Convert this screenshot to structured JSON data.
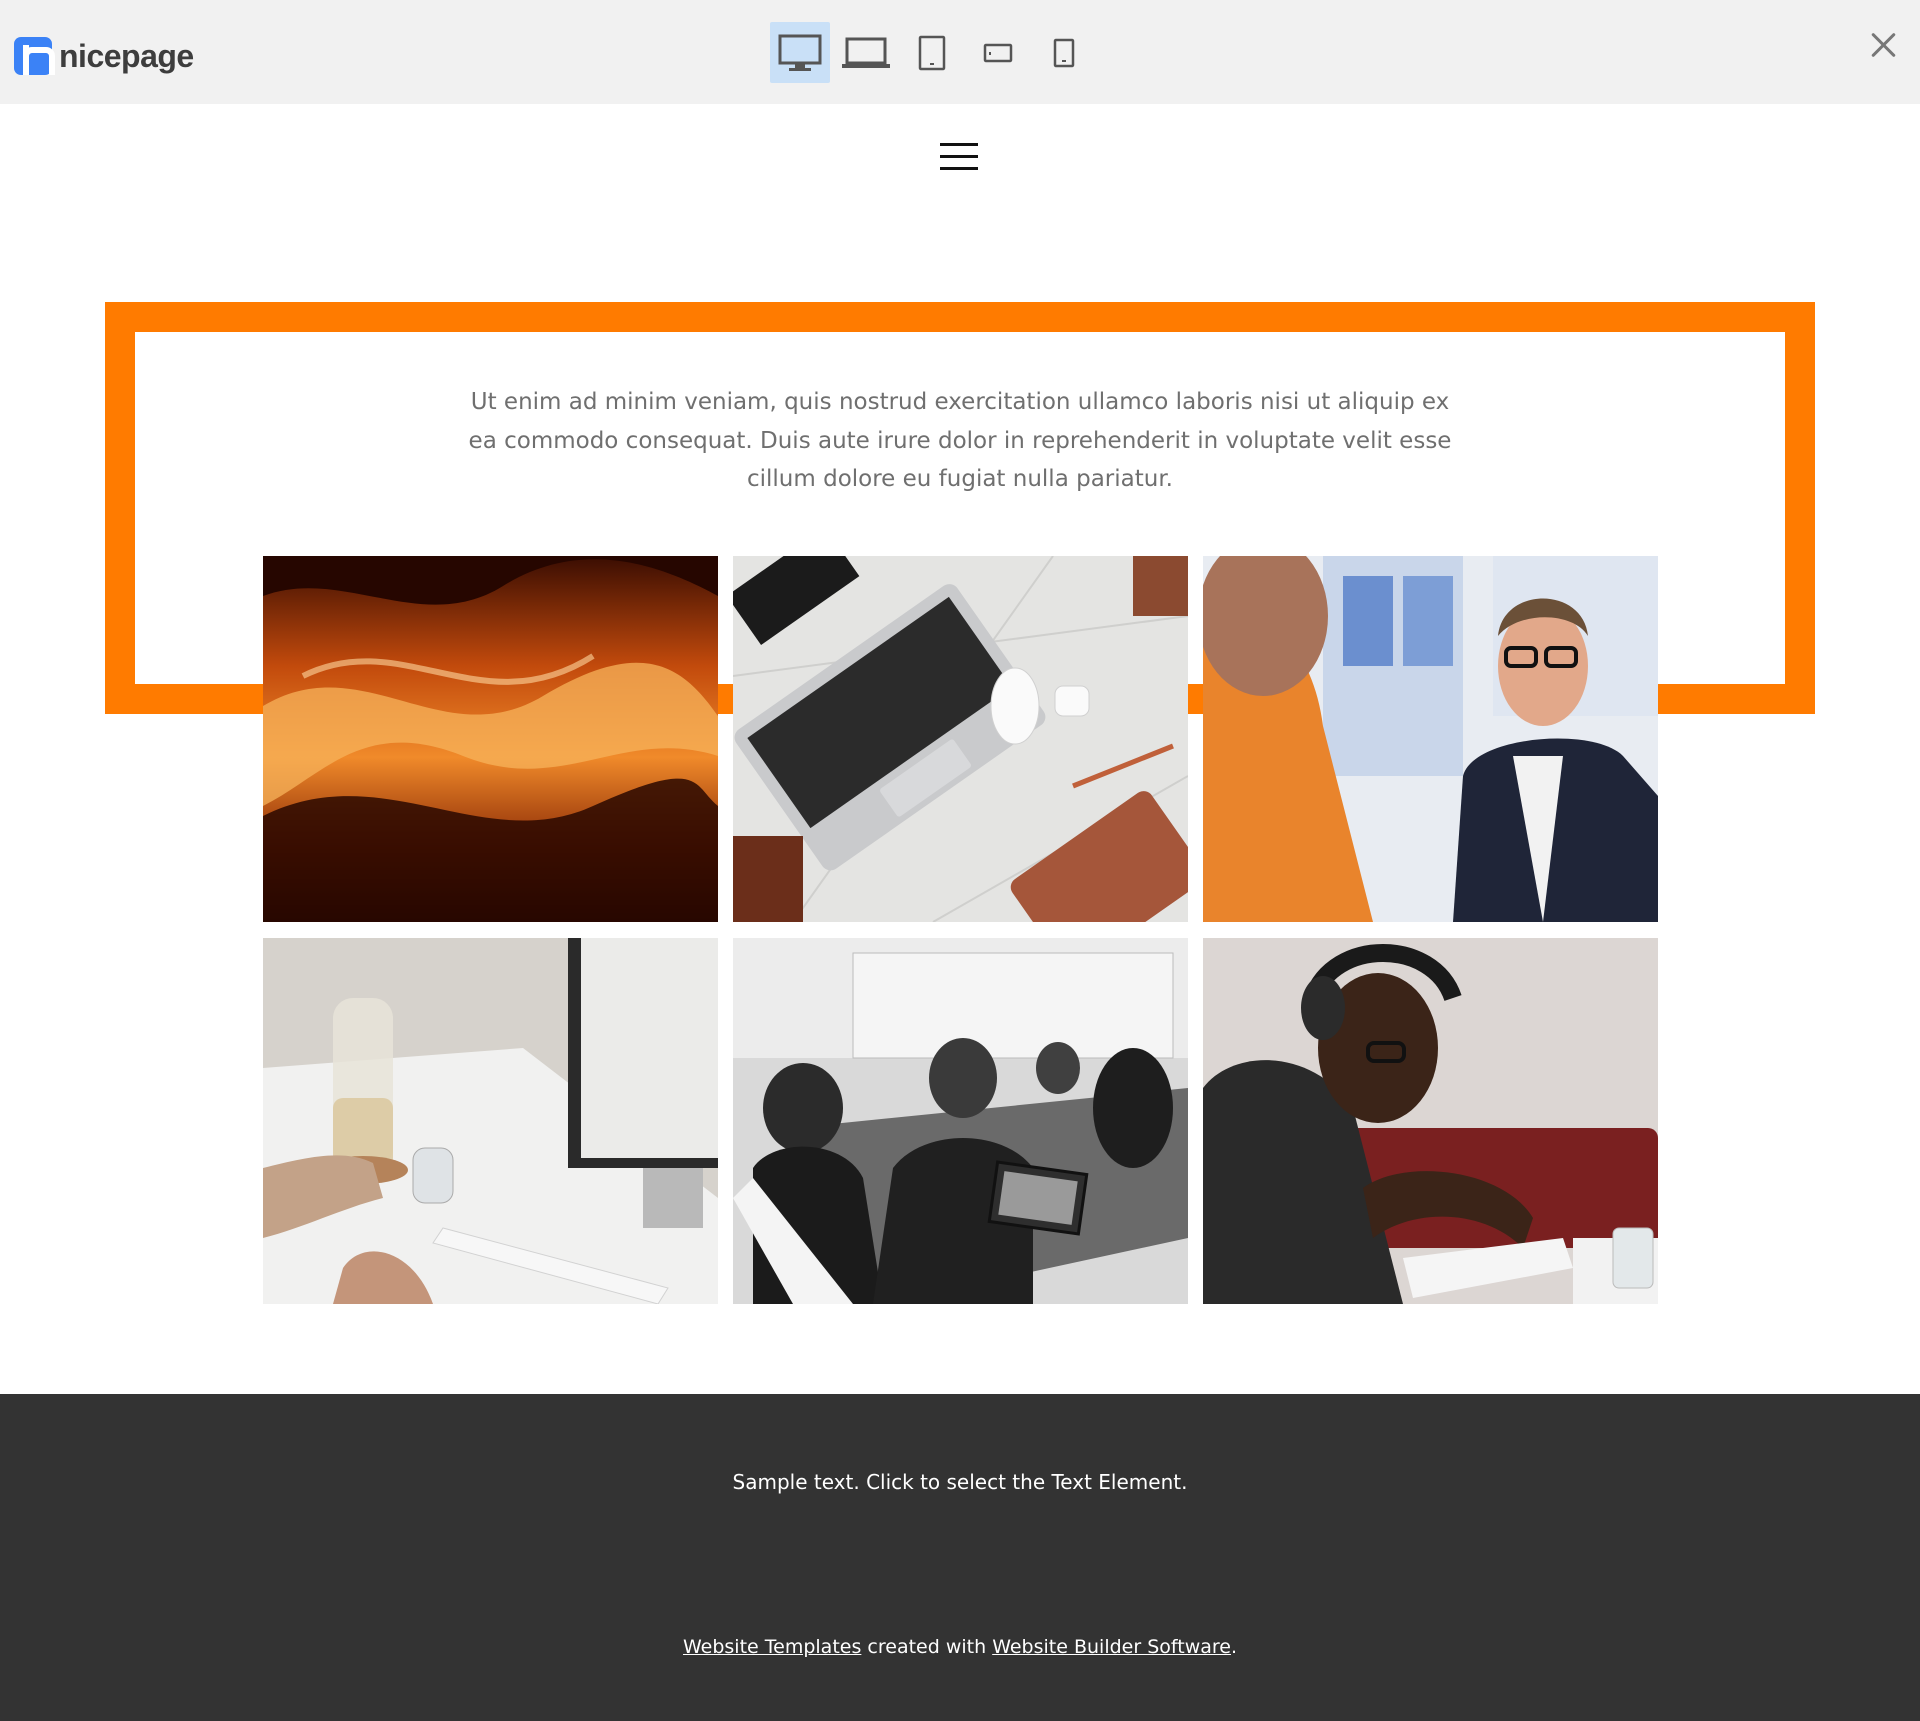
{
  "app": {
    "logo_text": "nicepage",
    "colors": {
      "accent": "#ff7b00",
      "toolbar_bg": "#f1f1f1",
      "active_device_bg": "#c9e0f7",
      "logo_blue": "#3b82f6",
      "footer_bg": "#333333"
    }
  },
  "toolbar": {
    "devices": [
      {
        "icon": "desktop-icon",
        "active": true
      },
      {
        "icon": "laptop-icon",
        "active": false
      },
      {
        "icon": "tablet-icon",
        "active": false
      },
      {
        "icon": "phone-landscape-icon",
        "active": false
      },
      {
        "icon": "phone-icon",
        "active": false
      }
    ],
    "close_icon": "close-icon"
  },
  "page": {
    "menu_icon": "hamburger-icon",
    "intro_text": "Ut enim ad minim veniam, quis nostrud exercitation ullamco laboris nisi ut aliquip ex ea commodo consequat. Duis aute irure dolor in reprehenderit in voluptate velit esse cillum dolore eu fugiat nulla pariatur.",
    "gallery": [
      {
        "subject": "orange canyon rock"
      },
      {
        "subject": "laptop on marble desk"
      },
      {
        "subject": "smiling man with glasses"
      },
      {
        "subject": "hand holding glass at desk"
      },
      {
        "subject": "team meeting black and white"
      },
      {
        "subject": "man with headphones writing"
      }
    ]
  },
  "footer": {
    "sample_text": "Sample text. Click to select the Text Element.",
    "link1": "Website Templates",
    "middle": " created with ",
    "link2": "Website Builder Software",
    "end": "."
  }
}
